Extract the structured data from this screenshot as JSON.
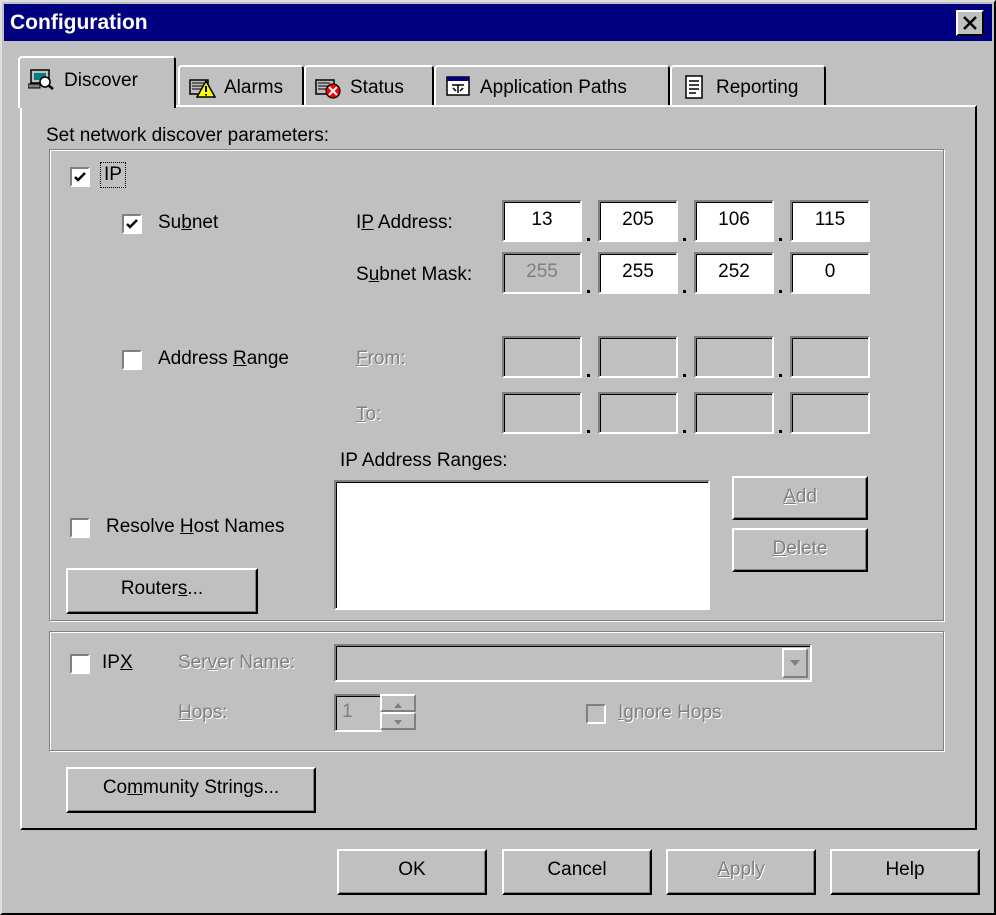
{
  "window": {
    "title": "Configuration",
    "close_symbol": "✕"
  },
  "tabs": [
    {
      "label": "Discover",
      "icon": "discover-icon",
      "active": true
    },
    {
      "label": "Alarms",
      "icon": "alarms-icon",
      "active": false
    },
    {
      "label": "Status",
      "icon": "status-icon",
      "active": false
    },
    {
      "label": "Application Paths",
      "icon": "application-paths-icon",
      "active": false
    },
    {
      "label": "Reporting",
      "icon": "reporting-icon",
      "active": false
    }
  ],
  "discover": {
    "heading": "Set network discover parameters:",
    "ip": {
      "label": "IP",
      "checked": true,
      "subnet": {
        "label_pre": "Su",
        "label_u": "b",
        "label_post": "net",
        "checked": true,
        "ip_address_label_pre": "I",
        "ip_address_label_u": "P",
        "ip_address_label_post": " Address:",
        "ip_address": [
          "13",
          "205",
          "106",
          "115"
        ],
        "subnet_mask_label_pre": "S",
        "subnet_mask_label_u": "u",
        "subnet_mask_label_post": "bnet Mask:",
        "subnet_mask": [
          "255",
          "255",
          "252",
          "0"
        ]
      },
      "address_range": {
        "label_pre": "Address ",
        "label_u": "R",
        "label_post": "ange",
        "checked": false,
        "from_label_u": "F",
        "from_label_post": "rom:",
        "to_label_u": "T",
        "to_label_post": "o:",
        "from": [
          "",
          "",
          "",
          ""
        ],
        "to": [
          "",
          "",
          "",
          ""
        ]
      },
      "ranges_label": "IP Address Ranges:",
      "ranges": [],
      "add_button_u": "A",
      "add_button_post": "dd",
      "delete_button_u": "D",
      "delete_button_post": "elete",
      "resolve_host_names_pre": "Resolve ",
      "resolve_host_names_u": "H",
      "resolve_host_names_post": "ost Names",
      "resolve_checked": false,
      "routers_button_pre": "Router",
      "routers_button_u": "s",
      "routers_button_post": "..."
    },
    "ipx": {
      "label_pre": "IP",
      "label_u": "X",
      "checked": false,
      "server_name_label_pre": "Ser",
      "server_name_label_u": "v",
      "server_name_label_post": "er Name:",
      "server_name": "",
      "hops_label_u": "H",
      "hops_label_post": "ops:",
      "hops": "1",
      "ignore_hops_u": "I",
      "ignore_hops_post": "gnore Hops",
      "ignore_hops_checked": false
    },
    "community_strings_pre": "Co",
    "community_strings_u": "m",
    "community_strings_post": "munity Strings..."
  },
  "footer": {
    "ok": "OK",
    "cancel": "Cancel",
    "apply_u": "A",
    "apply_post": "pply",
    "help": "Help"
  }
}
